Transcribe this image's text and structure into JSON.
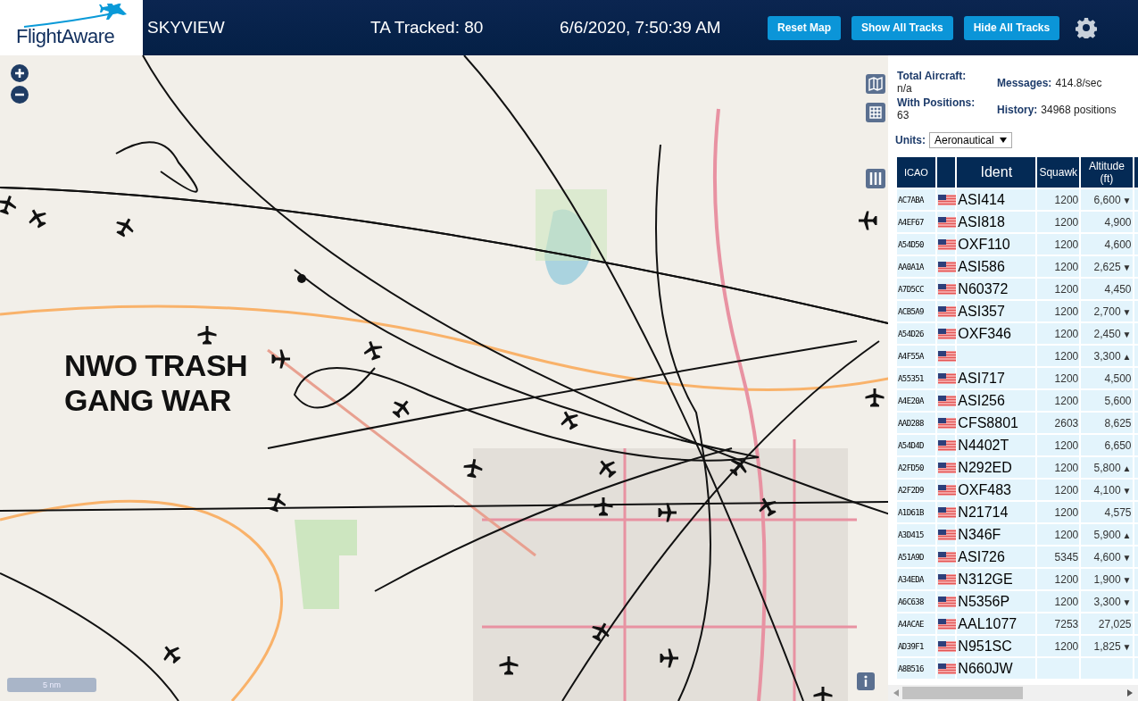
{
  "header": {
    "logo": "FlightAware",
    "title": "SKYVIEW",
    "tracked": "TA Tracked: 80",
    "datetime": "6/6/2020, 7:50:39 AM",
    "buttons": [
      "Reset Map",
      "Show All Tracks",
      "Hide All Tracks"
    ]
  },
  "map": {
    "annotation": [
      "NWO TRASH",
      "GANG WAR"
    ],
    "scale": "5 nm"
  },
  "stats": [
    {
      "label": "Total Aircraft:",
      "value": "n/a",
      "inline": false
    },
    {
      "label": "Messages:",
      "value": "414.8/sec",
      "inline": true
    },
    {
      "label": "With Positions:",
      "value": "63",
      "inline": false
    },
    {
      "label": "History:",
      "value": "34968 positions",
      "inline": true
    }
  ],
  "units": {
    "label": "Units:",
    "value": "Aeronautical"
  },
  "table": {
    "columns": [
      "ICAO",
      "Ident",
      "Squawk",
      "Altitude (ft)"
    ],
    "rows": [
      {
        "icao": "AC7ABA",
        "ident": "ASI414",
        "squawk": "1200",
        "altitude": "6,600",
        "trend": "▼"
      },
      {
        "icao": "A4EF67",
        "ident": "ASI818",
        "squawk": "1200",
        "altitude": "4,900",
        "trend": ""
      },
      {
        "icao": "A54D50",
        "ident": "OXF110",
        "squawk": "1200",
        "altitude": "4,600",
        "trend": ""
      },
      {
        "icao": "AA0A1A",
        "ident": "ASI586",
        "squawk": "1200",
        "altitude": "2,625",
        "trend": "▼"
      },
      {
        "icao": "A7D5CC",
        "ident": "N60372",
        "squawk": "1200",
        "altitude": "4,450",
        "trend": ""
      },
      {
        "icao": "ACB5A9",
        "ident": "ASI357",
        "squawk": "1200",
        "altitude": "2,700",
        "trend": "▼"
      },
      {
        "icao": "A54D26",
        "ident": "OXF346",
        "squawk": "1200",
        "altitude": "2,450",
        "trend": "▼"
      },
      {
        "icao": "A4F55A",
        "ident": "",
        "squawk": "1200",
        "altitude": "3,300",
        "trend": "▲"
      },
      {
        "icao": "A55351",
        "ident": "ASI717",
        "squawk": "1200",
        "altitude": "4,500",
        "trend": ""
      },
      {
        "icao": "A4E20A",
        "ident": "ASI256",
        "squawk": "1200",
        "altitude": "5,600",
        "trend": ""
      },
      {
        "icao": "AAD288",
        "ident": "CFS8801",
        "squawk": "2603",
        "altitude": "8,625",
        "trend": ""
      },
      {
        "icao": "A54D4D",
        "ident": "N4402T",
        "squawk": "1200",
        "altitude": "6,650",
        "trend": ""
      },
      {
        "icao": "A2FD50",
        "ident": "N292ED",
        "squawk": "1200",
        "altitude": "5,800",
        "trend": "▲"
      },
      {
        "icao": "A2F2D9",
        "ident": "OXF483",
        "squawk": "1200",
        "altitude": "4,100",
        "trend": "▼"
      },
      {
        "icao": "A1D61B",
        "ident": "N21714",
        "squawk": "1200",
        "altitude": "4,575",
        "trend": ""
      },
      {
        "icao": "A3D415",
        "ident": "N346F",
        "squawk": "1200",
        "altitude": "5,900",
        "trend": "▲"
      },
      {
        "icao": "A51A9D",
        "ident": "ASI726",
        "squawk": "5345",
        "altitude": "4,600",
        "trend": "▼"
      },
      {
        "icao": "A34EDA",
        "ident": "N312GE",
        "squawk": "1200",
        "altitude": "1,900",
        "trend": "▼"
      },
      {
        "icao": "A6C638",
        "ident": "N5356P",
        "squawk": "1200",
        "altitude": "3,300",
        "trend": "▼"
      },
      {
        "icao": "A4ACAE",
        "ident": "AAL1077",
        "squawk": "7253",
        "altitude": "27,025",
        "trend": ""
      },
      {
        "icao": "AD39F1",
        "ident": "N951SC",
        "squawk": "1200",
        "altitude": "1,825",
        "trend": "▼"
      },
      {
        "icao": "A8B516",
        "ident": "N660JW",
        "squawk": "",
        "altitude": "",
        "trend": ""
      }
    ]
  }
}
